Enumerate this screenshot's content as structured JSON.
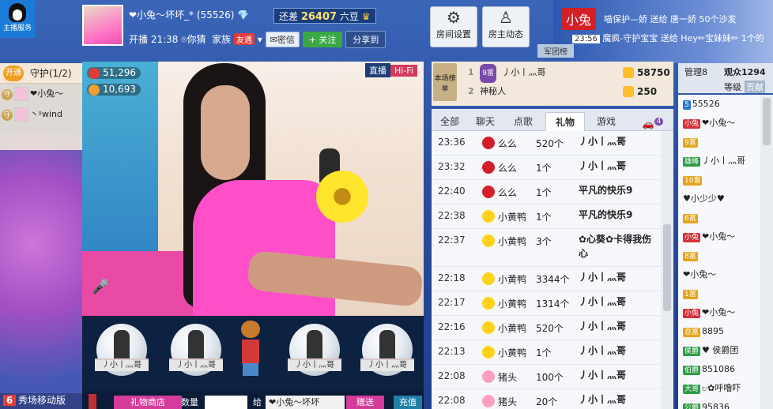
{
  "app": {
    "logo_label": "主播服务"
  },
  "host": {
    "name": "❤小兔〜坏坏_*",
    "id": "(55526)",
    "gap_label": "还差",
    "gap_value": "26407",
    "gap_unit": "六豆",
    "start_label": "开播",
    "start_time": "21:38",
    "location": "你猜",
    "family_label": "家族",
    "family_tag": "友遇",
    "msg_btn": "✉密信",
    "follow_btn": "+ 关注",
    "share_btn": "分享到"
  },
  "top_buttons": [
    {
      "label": "房间设置",
      "icon": "⚙"
    },
    {
      "label": "房主动态",
      "icon": "♙"
    }
  ],
  "broadcast": {
    "tag": "小兔",
    "line1": "喵保护—娇 送给 唐一娇 50个沙发",
    "time": "23:56",
    "line2": "魔疯-守护宝宝 送给 Hey✏宝妹妹✏ 1个的",
    "army": "军团榜"
  },
  "guard": {
    "open": "开通",
    "title": "守护(1/2)",
    "members": [
      {
        "badge": "守",
        "name": "❤小兔〜"
      },
      {
        "badge": "守",
        "name": "丶ᶳwind"
      }
    ]
  },
  "video": {
    "live_tag": "直播",
    "hifi_tag": "Hi-Fi",
    "stat_fans": "51,296",
    "stat_hot": "10,693"
  },
  "stage": {
    "seats": [
      "丿小丨灬哥",
      "丿小丨灬哥",
      "丿小丨灬哥",
      "丿小丨灬哥"
    ]
  },
  "giftbar": {
    "gift_shop": "礼物商店",
    "qty_label": "数量",
    "give": "给",
    "target": "❤小兔〜坏坏",
    "give_btn": "赠送",
    "recharge": "充值"
  },
  "mobile": {
    "num": "6",
    "label": "秀场移动版"
  },
  "ranking": {
    "flag": "本场榜单",
    "rows": [
      {
        "no": "1",
        "vip": "9富",
        "name": "丿小丨灬哥",
        "score": "58750"
      },
      {
        "no": "2",
        "vip": "",
        "name": "神秘人",
        "score": "250"
      }
    ]
  },
  "chat_tabs": [
    "全部",
    "聊天",
    "点歌",
    "礼物",
    "游戏"
  ],
  "chat_badge": "4",
  "gifts": [
    {
      "time": "23:36",
      "icon": "lip",
      "gift": "么么",
      "count": "520个",
      "from": "丿小丨灬哥"
    },
    {
      "time": "23:32",
      "icon": "lip",
      "gift": "么么",
      "count": "1个",
      "from": "丿小丨灬哥"
    },
    {
      "time": "22:40",
      "icon": "lip",
      "gift": "么么",
      "count": "1个",
      "from": "平凡的快乐9"
    },
    {
      "time": "22:38",
      "icon": "duck",
      "gift": "小黄鸭",
      "count": "1个",
      "from": "平凡的快乐9"
    },
    {
      "time": "22:37",
      "icon": "duck",
      "gift": "小黄鸭",
      "count": "3个",
      "from": "✿心葵✿卡得我伤心"
    },
    {
      "time": "22:18",
      "icon": "duck",
      "gift": "小黄鸭",
      "count": "3344个",
      "from": "丿小丨灬哥"
    },
    {
      "time": "22:17",
      "icon": "duck",
      "gift": "小黄鸭",
      "count": "1314个",
      "from": "丿小丨灬哥"
    },
    {
      "time": "22:16",
      "icon": "duck",
      "gift": "小黄鸭",
      "count": "520个",
      "from": "丿小丨灬哥"
    },
    {
      "time": "22:13",
      "icon": "duck",
      "gift": "小黄鸭",
      "count": "1个",
      "from": "丿小丨灬哥"
    },
    {
      "time": "22:08",
      "icon": "pig",
      "gift": "猪头",
      "count": "100个",
      "from": "丿小丨灬哥"
    },
    {
      "time": "22:08",
      "icon": "pig",
      "gift": "猪头",
      "count": "20个",
      "from": "丿小丨灬哥"
    }
  ],
  "users": {
    "tab_manage": "管理8",
    "tab_audience": "观众1294",
    "sub_level": "等级",
    "sub_contrib": "贡献",
    "list": [
      {
        "tags": [
          "5"
        ],
        "name": "55526"
      },
      {
        "tags": [
          "小兔"
        ],
        "name": "❤小兔〜"
      },
      {
        "tags": [
          "9富"
        ],
        "name": ""
      },
      {
        "tags": [
          "雄峰"
        ],
        "name": "丿小丨灬哥"
      },
      {
        "tags": [
          "10富"
        ],
        "name": ""
      },
      {
        "tags": [],
        "name": "♥小少少♥"
      },
      {
        "tags": [
          "6富"
        ],
        "name": ""
      },
      {
        "tags": [
          "小兔"
        ],
        "name": "❤小兔〜"
      },
      {
        "tags": [
          "8富"
        ],
        "name": ""
      },
      {
        "tags": [],
        "name": "❤小兔〜"
      },
      {
        "tags": [
          "1富"
        ],
        "name": ""
      },
      {
        "tags": [
          "小兔"
        ],
        "name": "❤小兔〜"
      },
      {
        "tags": [
          "总富"
        ],
        "name": "8895"
      },
      {
        "tags": [
          "侯爵"
        ],
        "name": "♥ 侯爵团"
      },
      {
        "tags": [
          "伯爵"
        ],
        "name": "851086"
      },
      {
        "tags": [
          "大哥"
        ],
        "name": "ಲ✿呼噜吓"
      },
      {
        "tags": [
          "公爵"
        ],
        "name": "95836"
      }
    ]
  }
}
